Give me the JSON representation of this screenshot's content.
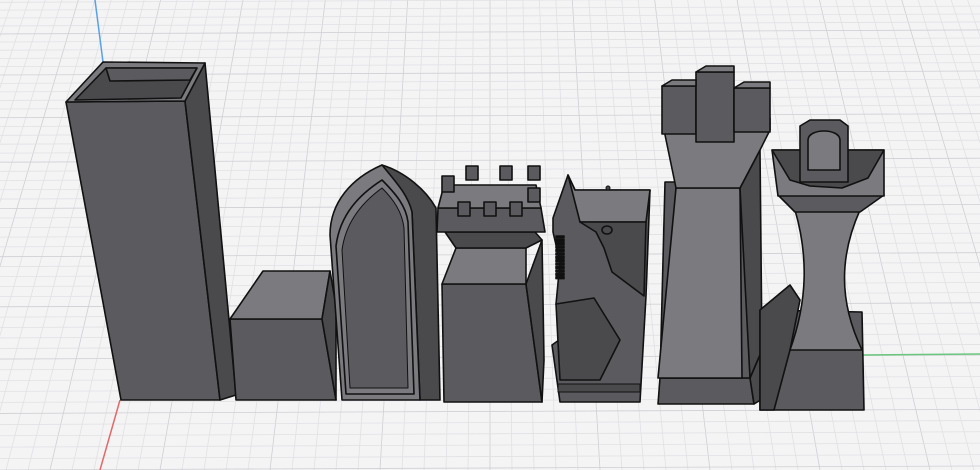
{
  "viewport": {
    "background": "#f4f4f5",
    "grid_minor_color": "#e1e1e4",
    "grid_major_color": "#cfcfd4"
  },
  "axes": {
    "x_axis_color": "#e06a6a",
    "y_axis_color": "#5aa0e8",
    "z_axis_color": "#6cc77e"
  },
  "materials": {
    "body_color": "#5b5b5f",
    "edge_color": "#111111"
  },
  "objects": [
    {
      "name": "tall-open-box"
    },
    {
      "name": "small-cube"
    },
    {
      "name": "gothic-arch-block"
    },
    {
      "name": "rook-piece"
    },
    {
      "name": "knight-piece"
    },
    {
      "name": "king-piece"
    },
    {
      "name": "queen-piece"
    }
  ]
}
